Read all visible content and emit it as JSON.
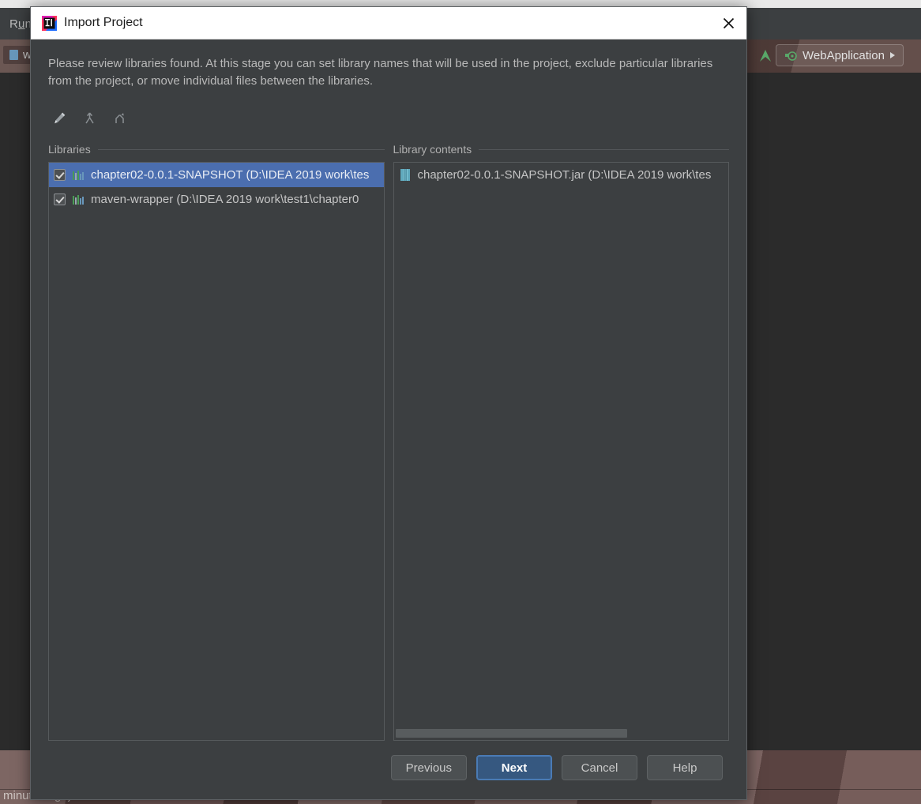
{
  "background": {
    "menu": {
      "label": "Run",
      "mnemonic": "u"
    },
    "editor_tab": {
      "label": "wel",
      "icon": "file-icon"
    },
    "run_config": {
      "label": "WebApplication",
      "icon": "run-config-icon",
      "caret": "chevron-down-icon"
    },
    "run_arrow_icon": "run-green-arrow-icon",
    "status_text": "minutes ago)"
  },
  "dialog": {
    "title": "Import Project",
    "app_icon": "intellij-idea-icon",
    "close_label": "close-icon",
    "description": "Please review libraries found. At this stage you can set library names that will be used in the project, exclude particular libraries from the project, or move individual files between the libraries.",
    "toolbar": [
      {
        "name": "edit-rename-library-button",
        "icon": "pencil-icon",
        "title": "Rename"
      },
      {
        "name": "merge-libraries-button",
        "icon": "merge-arrows-icon",
        "title": "Merge"
      },
      {
        "name": "split-library-button",
        "icon": "split-arrows-icon",
        "title": "Split"
      }
    ],
    "libraries_panel": {
      "header": "Libraries",
      "items": [
        {
          "label": "chapter02-0.0.1-SNAPSHOT (D:\\IDEA 2019 work\\tes",
          "checked": true,
          "selected": true,
          "icon": "library-bars-icon"
        },
        {
          "label": "maven-wrapper (D:\\IDEA 2019 work\\test1\\chapter0",
          "checked": true,
          "selected": false,
          "icon": "library-bars-icon"
        }
      ]
    },
    "contents_panel": {
      "header": "Library contents",
      "items": [
        {
          "label": "chapter02-0.0.1-SNAPSHOT.jar (D:\\IDEA 2019 work\\tes",
          "icon": "jar-archive-icon"
        }
      ],
      "scrollbar": {
        "thumb_percent": 70
      }
    },
    "footer_buttons": [
      {
        "name": "previous-button",
        "label": "Previous",
        "default": false
      },
      {
        "name": "next-button",
        "label": "Next",
        "default": true
      },
      {
        "name": "cancel-button",
        "label": "Cancel",
        "default": false
      },
      {
        "name": "help-button",
        "label": "Help",
        "default": false
      }
    ]
  },
  "colors": {
    "dialog_bg": "#3c3f41",
    "selection_blue": "#4b6eaf",
    "default_button_blue": "#365880",
    "titlebar_white": "#ffffff",
    "text_primary": "#c5c5c5"
  }
}
